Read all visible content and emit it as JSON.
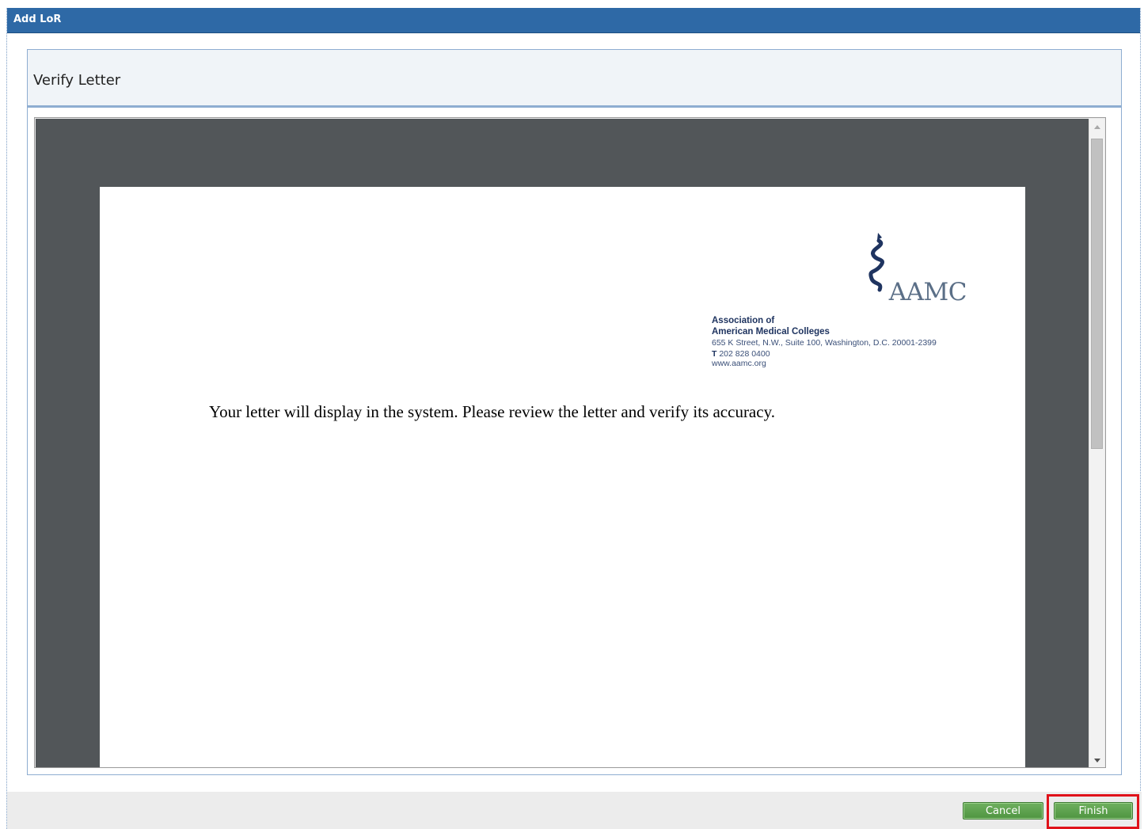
{
  "window": {
    "title": "Add LoR"
  },
  "header": {
    "title": "Verify Letter"
  },
  "viewer": {
    "letterhead": {
      "logo_icon": "caduceus-serpent-icon",
      "wordmark": "AAMC",
      "org_line1": "Association of",
      "org_line2": "American Medical Colleges",
      "address": "655 K Street, N.W., Suite 100, Washington, D.C. 20001-2399",
      "phone_prefix": "T",
      "phone": "202 828 0400",
      "website": "www.aamc.org"
    },
    "body_text": "Your letter will display in the system. Please review the letter and verify its accuracy."
  },
  "footer": {
    "cancel_label": "Cancel",
    "finish_label": "Finish"
  },
  "colors": {
    "titlebar": "#2e69a6",
    "button_green": "#5aa14b",
    "highlight_red": "#e0121a",
    "viewer_background": "#525659"
  }
}
